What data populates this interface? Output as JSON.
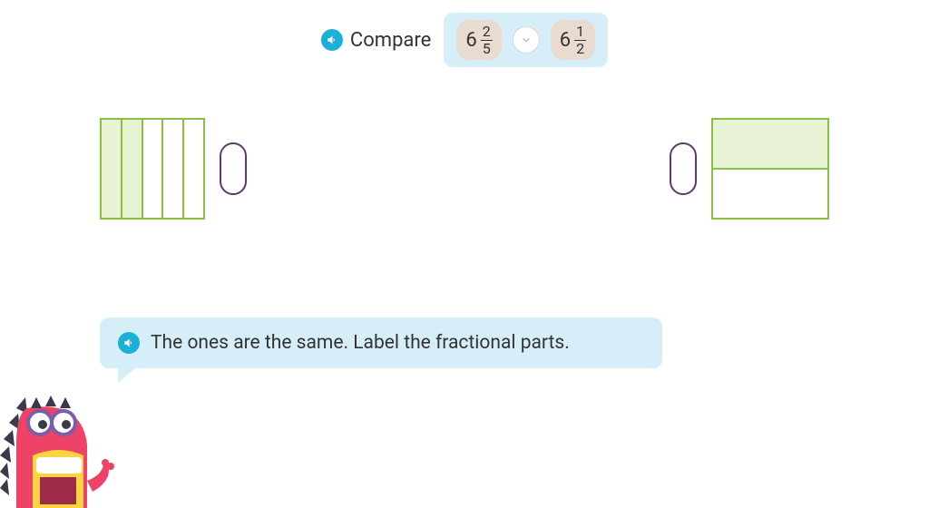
{
  "header": {
    "compare_label": "Compare",
    "left_mixed": {
      "whole": "6",
      "num": "2",
      "den": "5"
    },
    "right_mixed": {
      "whole": "6",
      "num": "1",
      "den": "2"
    }
  },
  "models": {
    "left": {
      "parts": 5,
      "filled": 2,
      "orientation": "vertical"
    },
    "right": {
      "parts": 2,
      "filled": 1,
      "orientation": "horizontal"
    }
  },
  "speech": {
    "text": "The ones are the same. Label the fractional parts."
  },
  "icons": {
    "audio": "audio-icon",
    "chevron": "chevron-down-icon"
  },
  "colors": {
    "accent_blue": "#d6eef7",
    "audio_blue": "#1cb0d8",
    "bar_green": "#8bbf3f",
    "fill_green": "#e8f3d5",
    "pill_purple": "#5e3a6b",
    "mixed_bg": "#e9dbcf"
  }
}
